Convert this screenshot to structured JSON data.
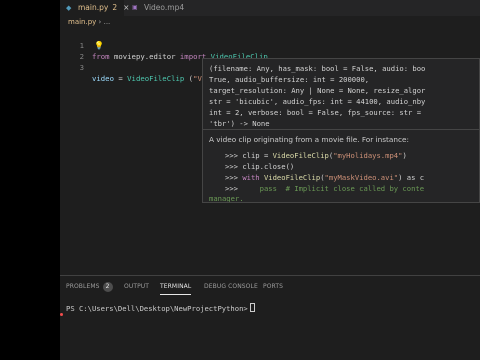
{
  "tabs": [
    {
      "label": "main.py",
      "badge": "2",
      "icon": "python-file-icon",
      "close": "×"
    },
    {
      "label": "Video.mp4",
      "icon": "video-file-icon"
    }
  ],
  "breadcrumb": {
    "file": "main.py",
    "separator": "›",
    "more": "..."
  },
  "editor": {
    "lines": [
      {
        "number": "1",
        "kw1": "from",
        "module": "moviepy.editor",
        "kw2": "import",
        "cls": "VideoFileClip"
      },
      {
        "number": "2"
      },
      {
        "number": "3",
        "var": "video",
        "op": " = ",
        "cls": "VideoFileClip",
        "open": " (",
        "str": "\"Video.mp4\"",
        "close": ")"
      }
    ],
    "lightbulb_icon": "lightbulb-icon"
  },
  "hover": {
    "signature": [
      "(filename: Any, has_mask: bool = False, audio: boo",
      "True, audio_buffersize: int = 200000,",
      "target_resolution: Any | None = None, resize_algor",
      "str = 'bicubic', audio_fps: int = 44100, audio_nby",
      "int = 2, verbose: bool = False, fps_source: str =",
      "'tbr') -> None"
    ],
    "description": "A video clip originating from a movie file. For instance:",
    "examples": [
      {
        "prompt": ">>> ",
        "pre": "clip = ",
        "fn": "VideoFileClip",
        "open": "(",
        "s": "\"myHolidays.mp4\"",
        "post": ")"
      },
      {
        "prompt": ">>> ",
        "pre": "clip.close()"
      },
      {
        "prompt": ">>> ",
        "k": "with ",
        "fn": "VideoFileClip",
        "open": "(",
        "s": "\"myMaskVideo.avi\"",
        "post": ") as c"
      },
      {
        "prompt": ">>>     ",
        "pl": "pass  # Implicit close called by conte"
      }
    ],
    "manager_text": "manager."
  },
  "panel": {
    "tabs": [
      {
        "label": "PROBLEMS",
        "badge": "2"
      },
      {
        "label": "OUTPUT"
      },
      {
        "label": "TERMINAL",
        "active": true
      },
      {
        "label": "DEBUG CONSOLE"
      },
      {
        "label": "PORTS"
      }
    ],
    "terminal_prompt": "PS C:\\Users\\Dell\\Desktop\\NewProjectPython>"
  }
}
